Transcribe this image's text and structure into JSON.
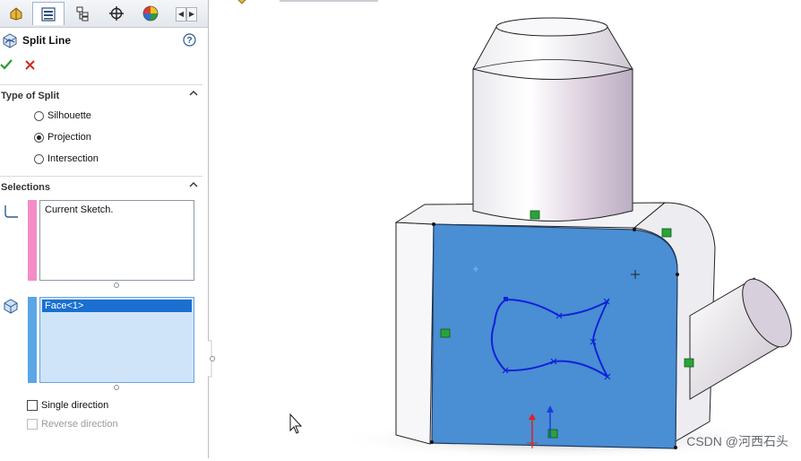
{
  "tabs": [
    {
      "icon": "feature-manager-icon",
      "active": false
    },
    {
      "icon": "property-manager-icon",
      "active": true
    },
    {
      "icon": "configuration-manager-icon",
      "active": false
    },
    {
      "icon": "dim-xpert-icon",
      "active": false
    },
    {
      "icon": "display-manager-icon",
      "active": false
    }
  ],
  "tab_scroll": {
    "left": "◀",
    "right": "▶"
  },
  "property_manager": {
    "title": "Split Line",
    "help_icon": "help-icon",
    "ok_icon": "ok-checkmark-icon",
    "cancel_icon": "cancel-x-icon"
  },
  "type_of_split": {
    "label": "Type of Split",
    "options": [
      {
        "label": "Silhouette",
        "checked": false
      },
      {
        "label": "Projection",
        "checked": true
      },
      {
        "label": "Intersection",
        "checked": false
      }
    ]
  },
  "selections": {
    "label": "Selections",
    "sketch_box": {
      "value": "Current Sketch.",
      "color": "#f48cc6",
      "icon": "sketch-icon"
    },
    "face_box": {
      "items": [
        "Face<1>"
      ],
      "color": "#5aa6e6",
      "icon": "face-icon"
    },
    "single_direction": {
      "label": "Single direction",
      "checked": false
    },
    "reverse_direction": {
      "label": "Reverse direction",
      "checked": false,
      "enabled": false
    }
  },
  "colors": {
    "selected_face": "#4a8ed3",
    "split_curve": "#1022d8",
    "selection_highlight": "#2f86d6"
  },
  "watermark": "CSDN @河西石头"
}
